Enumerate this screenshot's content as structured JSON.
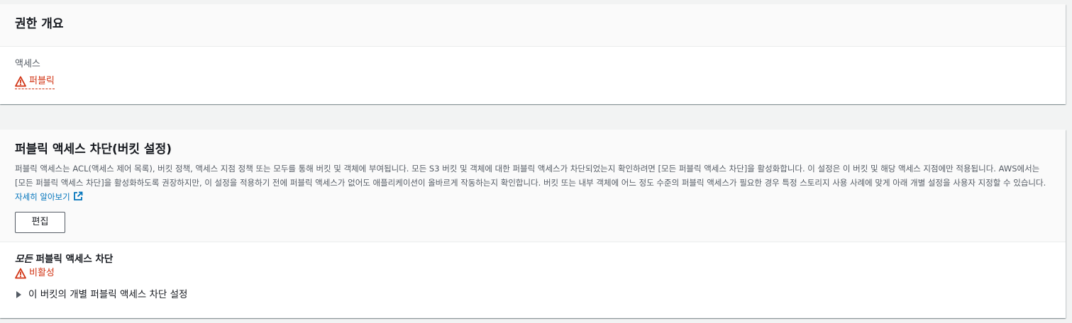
{
  "permissions_overview": {
    "title": "권한 개요",
    "access_label": "액세스",
    "access_value": "퍼블릭"
  },
  "block_public_access": {
    "title": "퍼블릭 액세스 차단(버킷 설정)",
    "description": "퍼블릭 액세스는 ACL(액세스 제어 목록), 버킷 정책, 액세스 지점 정책 또는 모두를 통해 버킷 및 객체에 부여됩니다. 모든 S3 버킷 및 객체에 대한 퍼블릭 액세스가 차단되었는지 확인하려면 [모든 퍼블릭 액세스 차단]을 활성화합니다. 이 설정은 이 버킷 및 해당 액세스 지점에만 적용됩니다. AWS에서는 [모든 퍼블릭 액세스 차단]을 활성화하도록 권장하지만, 이 설정을 적용하기 전에 퍼블릭 액세스가 없어도 애플리케이션이 올바르게 작동하는지 확인합니다. 버킷 또는 내부 객체에 어느 정도 수준의 퍼블릭 액세스가 필요한 경우 특정 스토리지 사용 사례에 맞게 아래 개별 설정을 사용자 지정할 수 있습니다.",
    "learn_more": "자세히 알아보기",
    "edit_label": "편집",
    "block_all_prefix": "모든",
    "block_all_rest": " 퍼블릭 액세스 차단",
    "block_all_status": "비활성",
    "individual_settings_label": "이 버킷의 개별 퍼블릭 액세스 차단 설정"
  },
  "colors": {
    "warning": "#d13212",
    "link": "#0073bb",
    "panel_header_bg": "#fafafa",
    "page_bg": "#f2f3f3"
  },
  "icons": {
    "warning": "warning-triangle-icon",
    "external": "external-link-icon",
    "caret": "caret-right-icon"
  }
}
